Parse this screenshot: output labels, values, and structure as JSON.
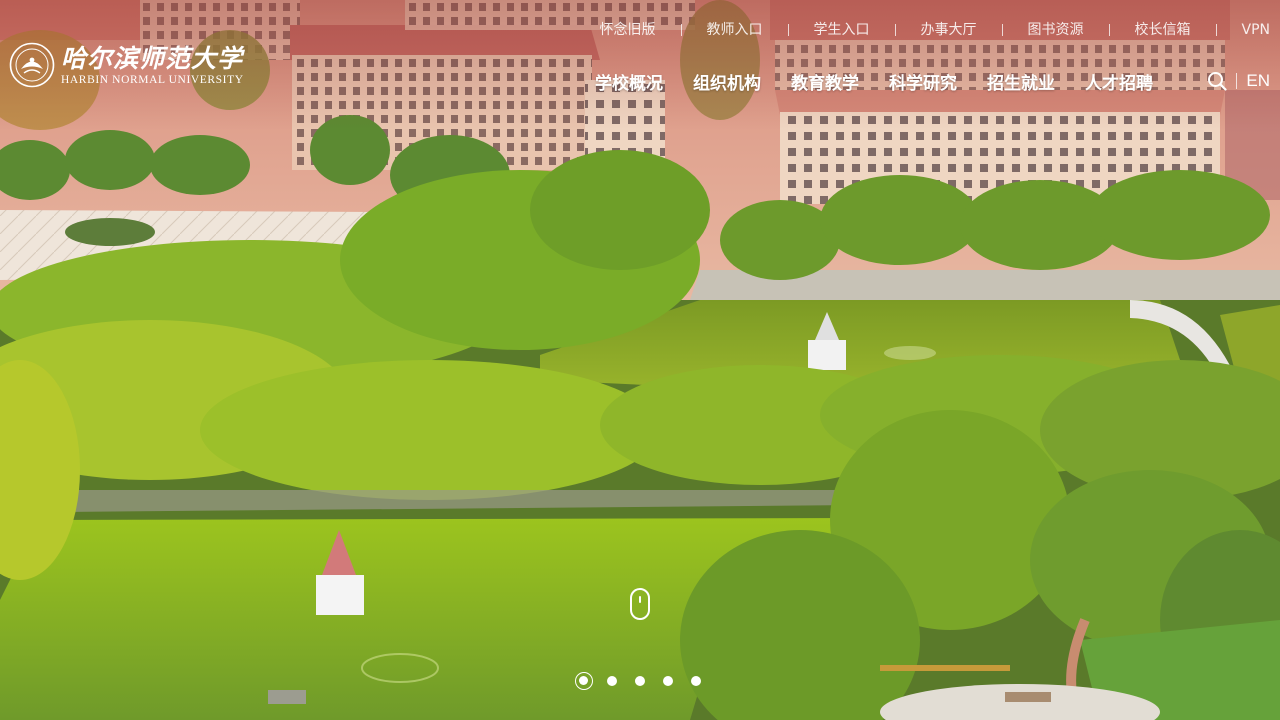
{
  "brand": {
    "name_cn": "哈尔滨师范大学",
    "name_en": "HARBIN NORMAL UNIVERSITY"
  },
  "utility_links": [
    "怀念旧版",
    "教师入口",
    "学生入口",
    "办事大厅",
    "图书资源",
    "校长信箱",
    "VPN"
  ],
  "main_nav": [
    "学校概况",
    "组织机构",
    "教育教学",
    "科学研究",
    "招生就业",
    "人才招聘"
  ],
  "lang_switch": "EN",
  "icons": {
    "search": "search-icon",
    "scroll": "mouse-scroll-icon",
    "logo": "university-emblem-icon"
  },
  "carousel": {
    "slide_count": 5,
    "active_index": 0
  },
  "colors": {
    "nav_text": "#ffffff",
    "building_tint": "#e8a59a",
    "foliage": "#7fae2a",
    "pond": "#8fb21e"
  }
}
